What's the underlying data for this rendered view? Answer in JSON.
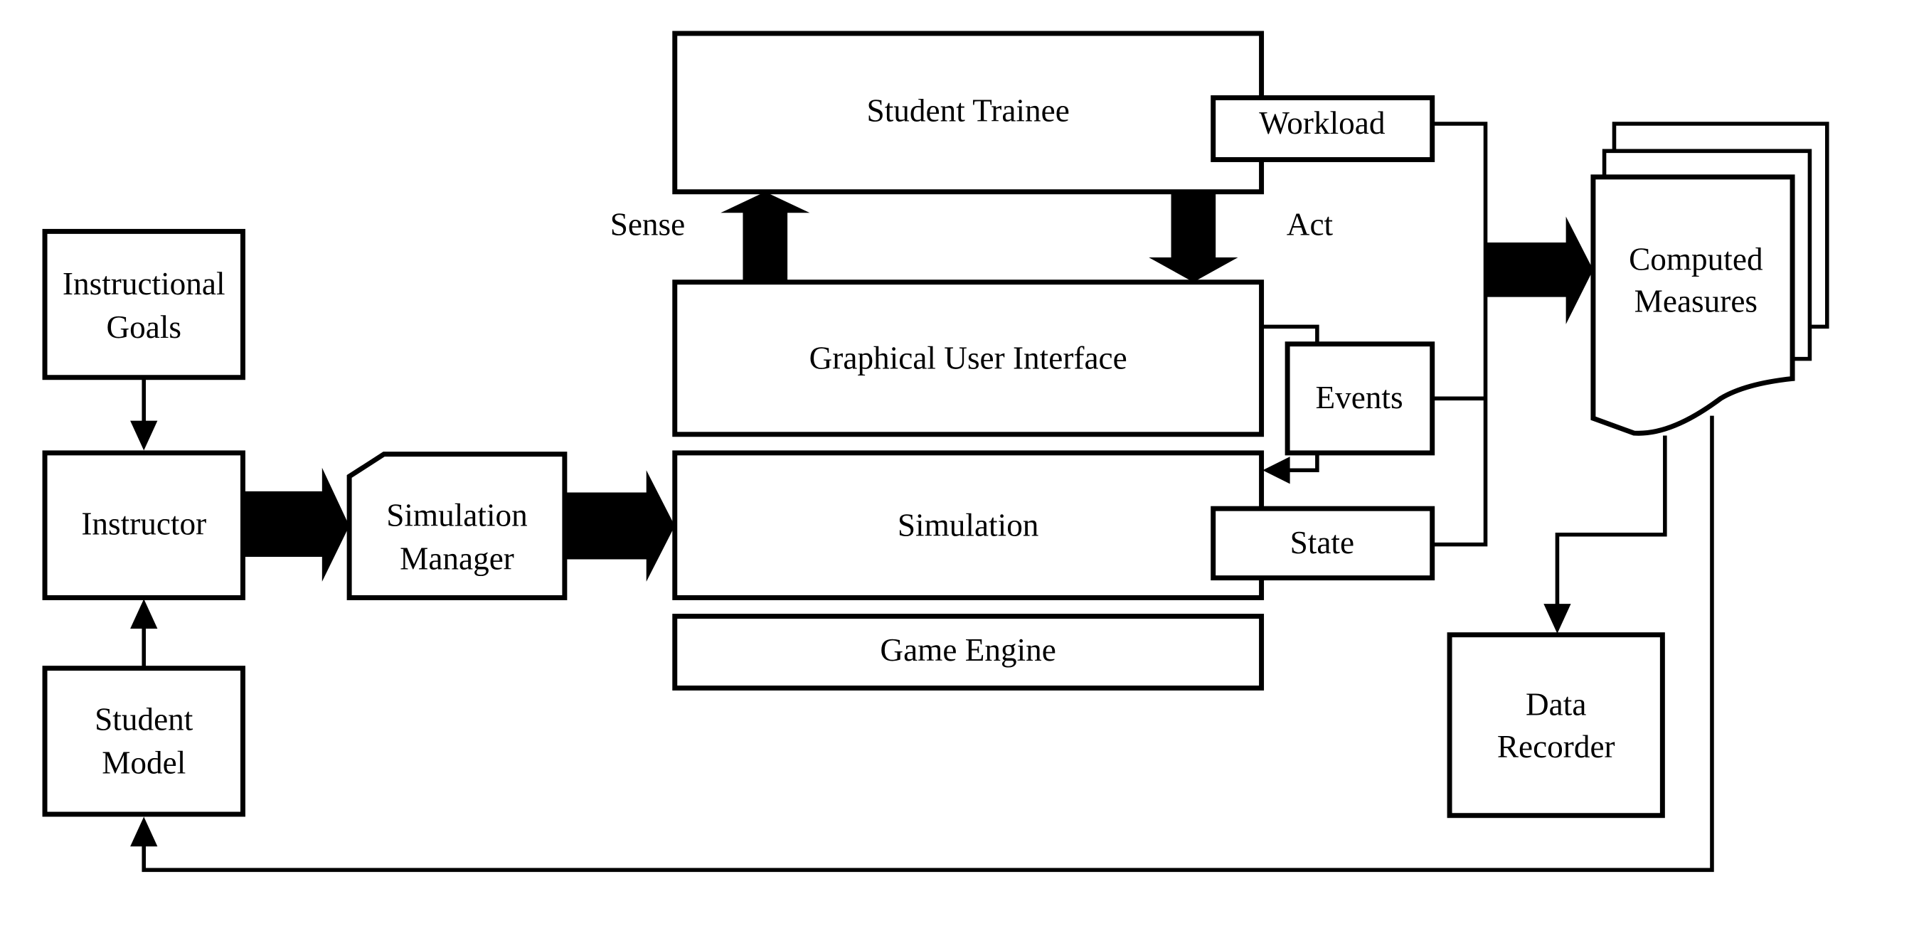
{
  "diagram": {
    "nodes": {
      "instructional_goals": [
        "Instructional",
        "Goals"
      ],
      "instructor": "Instructor",
      "student_model": [
        "Student",
        "Model"
      ],
      "simulation_manager": [
        "Simulation",
        "Manager"
      ],
      "student_trainee": "Student Trainee",
      "graphical_user_interface": "Graphical User Interface",
      "simulation": "Simulation",
      "game_engine": "Game Engine",
      "workload": "Workload",
      "events": "Events",
      "state": "State",
      "computed_measures": [
        "Computed",
        "Measures"
      ],
      "data_recorder": [
        "Data",
        "Recorder"
      ]
    },
    "edge_labels": {
      "sense": "Sense",
      "act": "Act"
    },
    "edges": [
      {
        "from": "Instructional Goals",
        "to": "Instructor",
        "style": "thin-arrow"
      },
      {
        "from": "Student Model",
        "to": "Instructor",
        "style": "thin-arrow"
      },
      {
        "from": "Instructor",
        "to": "Simulation Manager",
        "style": "block-arrow"
      },
      {
        "from": "Simulation Manager",
        "to": "Simulation",
        "style": "block-arrow"
      },
      {
        "from": "Graphical User Interface",
        "to": "Student Trainee",
        "label": "Sense",
        "style": "block-arrow"
      },
      {
        "from": "Student Trainee",
        "to": "Graphical User Interface",
        "label": "Act",
        "style": "block-arrow"
      },
      {
        "from": "Graphical User Interface",
        "to": "Simulation",
        "via": "Events",
        "style": "thin-arrow"
      },
      {
        "from": "Workload / Events / State",
        "to": "Computed Measures",
        "style": "block-arrow"
      },
      {
        "from": "Computed Measures",
        "to": "Data Recorder",
        "style": "thin-arrow"
      },
      {
        "from": "Computed Measures",
        "to": "Student Model",
        "style": "thin-arrow"
      }
    ]
  }
}
